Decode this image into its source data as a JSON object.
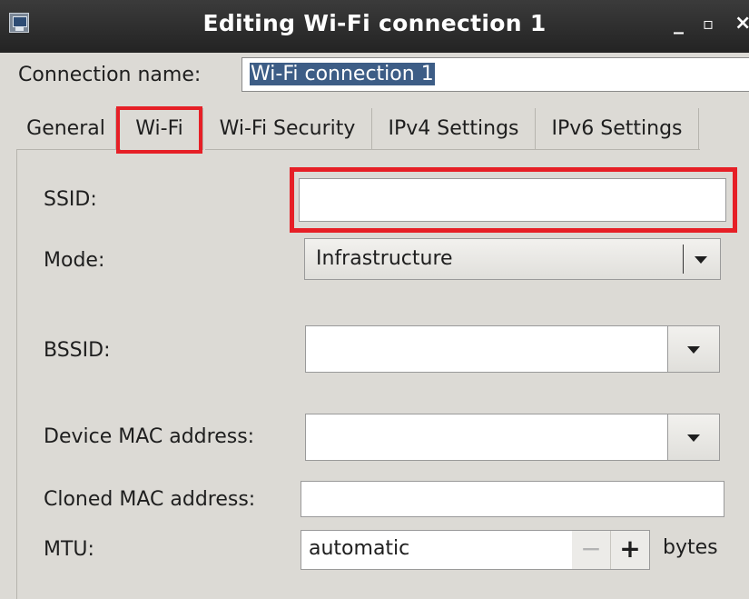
{
  "window": {
    "title": "Editing Wi-Fi connection 1",
    "minimize_glyph": "_",
    "maximize_glyph": "▫",
    "close_glyph": "×"
  },
  "connection": {
    "label": "Connection name:",
    "value": "Wi-Fi connection 1"
  },
  "tabs": [
    {
      "label": "General"
    },
    {
      "label": "Wi-Fi",
      "active": true
    },
    {
      "label": "Wi-Fi Security"
    },
    {
      "label": "IPv4 Settings"
    },
    {
      "label": "IPv6 Settings"
    }
  ],
  "wifi": {
    "ssid_label": "SSID:",
    "ssid_value": "",
    "mode_label": "Mode:",
    "mode_value": "Infrastructure",
    "bssid_label": "BSSID:",
    "bssid_value": "",
    "device_mac_label": "Device MAC address:",
    "device_mac_value": "",
    "cloned_mac_label": "Cloned MAC address:",
    "cloned_mac_value": "",
    "mtu_label": "MTU:",
    "mtu_value": "automatic",
    "mtu_minus": "−",
    "mtu_plus": "+",
    "mtu_unit": "bytes"
  },
  "highlight_color": "#e61f26",
  "icons": [
    "network-connection-icon",
    "chevron-down-icon"
  ]
}
